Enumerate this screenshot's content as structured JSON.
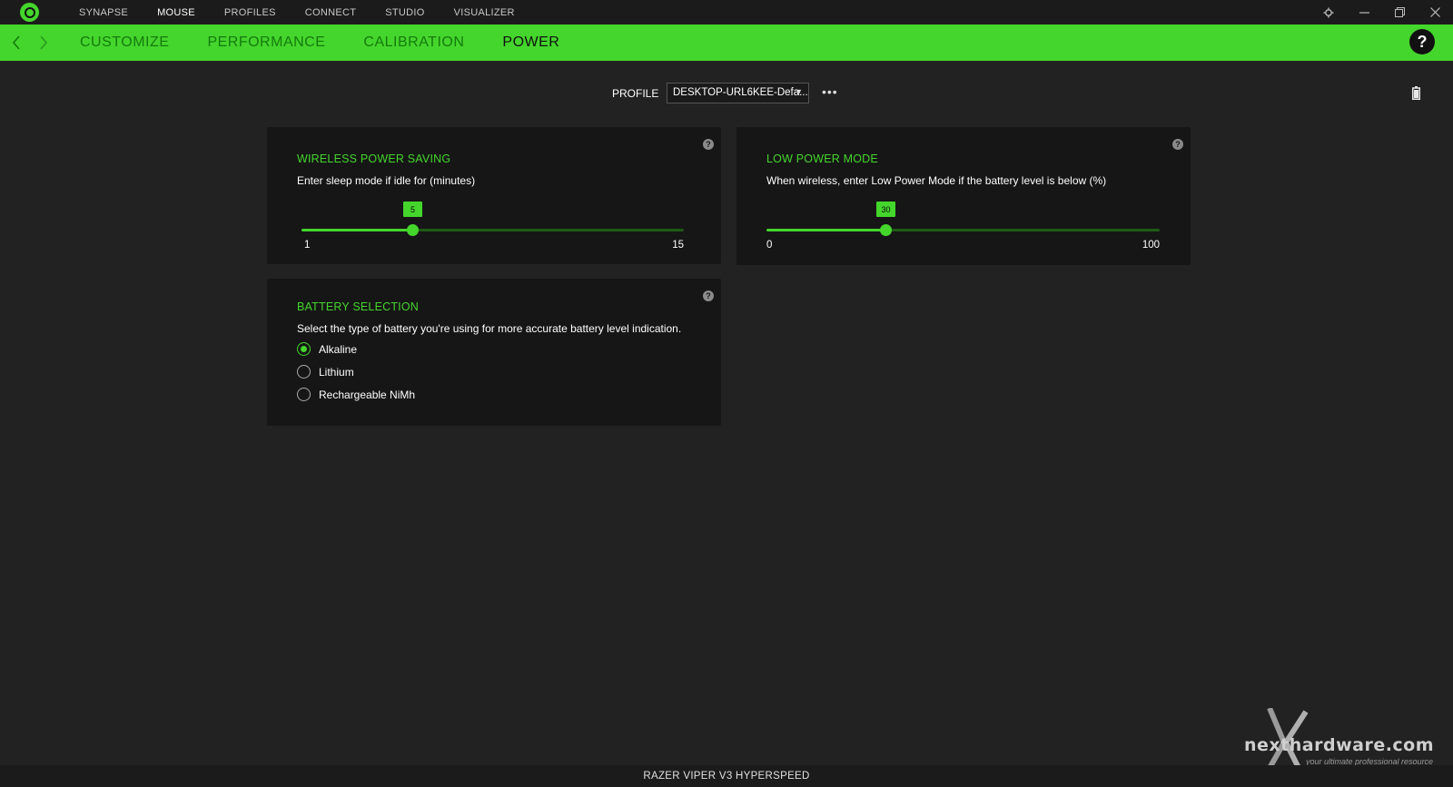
{
  "topnav": {
    "items": [
      {
        "label": "SYNAPSE",
        "active": false
      },
      {
        "label": "MOUSE",
        "active": true
      },
      {
        "label": "PROFILES",
        "active": false
      },
      {
        "label": "CONNECT",
        "active": false
      },
      {
        "label": "STUDIO",
        "active": false
      },
      {
        "label": "VISUALIZER",
        "active": false
      }
    ]
  },
  "subnav": {
    "tabs": [
      {
        "label": "CUSTOMIZE",
        "active": false
      },
      {
        "label": "PERFORMANCE",
        "active": false
      },
      {
        "label": "CALIBRATION",
        "active": false
      },
      {
        "label": "POWER",
        "active": true
      }
    ],
    "help_label": "?"
  },
  "profile": {
    "label": "PROFILE",
    "value": "DESKTOP-URL6KEE-Defa...",
    "more": "•••"
  },
  "wireless_power_saving": {
    "title": "WIRELESS POWER SAVING",
    "description": "Enter sleep mode if idle for (minutes)",
    "value": "5",
    "min": "1",
    "max": "15",
    "help": "?"
  },
  "low_power_mode": {
    "title": "LOW POWER MODE",
    "description": "When wireless, enter Low Power Mode if the battery level is below (%)",
    "value": "30",
    "min": "0",
    "max": "100",
    "help": "?"
  },
  "battery_selection": {
    "title": "BATTERY SELECTION",
    "description": "Select the type of battery you're using for more accurate battery level indication.",
    "options": [
      {
        "label": "Alkaline",
        "checked": true
      },
      {
        "label": "Lithium",
        "checked": false
      },
      {
        "label": "Rechargeable NiMh",
        "checked": false
      }
    ],
    "help": "?"
  },
  "footer": {
    "device_name": "RAZER VIPER V3 HYPERSPEED"
  },
  "watermark": {
    "brand": "nexthardware.com",
    "tagline": "your ultimate professional resource"
  },
  "colors": {
    "accent": "#44d62c",
    "background": "#222222",
    "card": "#161616"
  }
}
